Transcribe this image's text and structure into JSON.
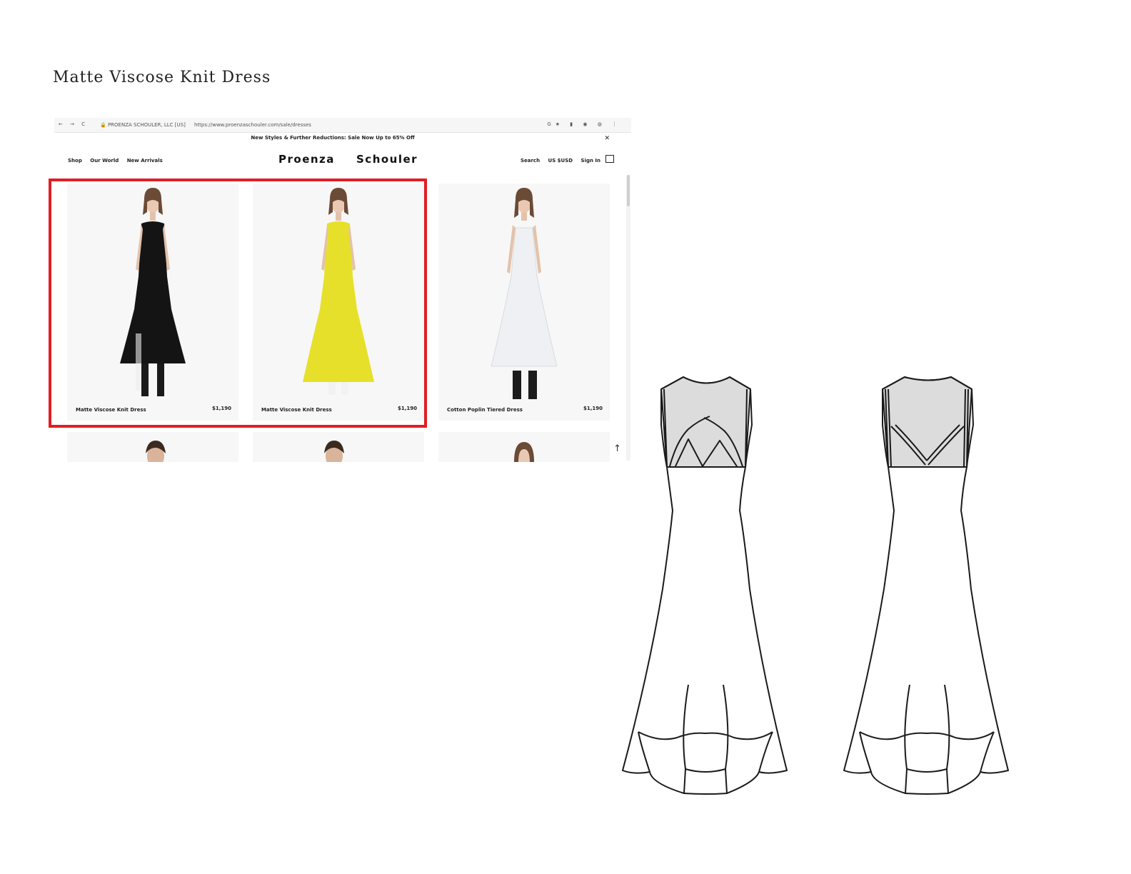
{
  "page": {
    "title": "Matte Viscose Knit Dress"
  },
  "browser": {
    "nav_icons": "← → C",
    "site_label": "🔒 PROENZA SCHOULER, LLC [US]",
    "url": "https://www.proenzaschouler.com/sale/dresses",
    "tool_icons": "G★ ▮ ◉ ◍ ⋮"
  },
  "store": {
    "promo": "New Styles & Further Reductions: Sale Now Up to 65% Off",
    "promo_close": "✕",
    "nav_left": [
      "Shop",
      "Our World",
      "New Arrivals"
    ],
    "logo_left": "Proenza",
    "logo_right": "Schouler",
    "nav_right": [
      "Search",
      "US $USD",
      "Sign In"
    ],
    "back_to_top": "↑"
  },
  "products": [
    {
      "name": "Matte Viscose Knit Dress",
      "price": "$1,190",
      "dress_color": "#141414",
      "shoe_color": "#1a1a1a"
    },
    {
      "name": "Matte Viscose Knit Dress",
      "price": "$1,190",
      "dress_color": "#e6e02a",
      "shoe_color": "#f2f2f2"
    },
    {
      "name": "Cotton Poplin Tiered Dress",
      "price": "$1,190",
      "dress_color": "#eef0f3",
      "shoe_color": "#1c1c1c"
    }
  ],
  "colors": {
    "highlight": "#e01e26",
    "yoke_fill": "#dcdcdc"
  }
}
